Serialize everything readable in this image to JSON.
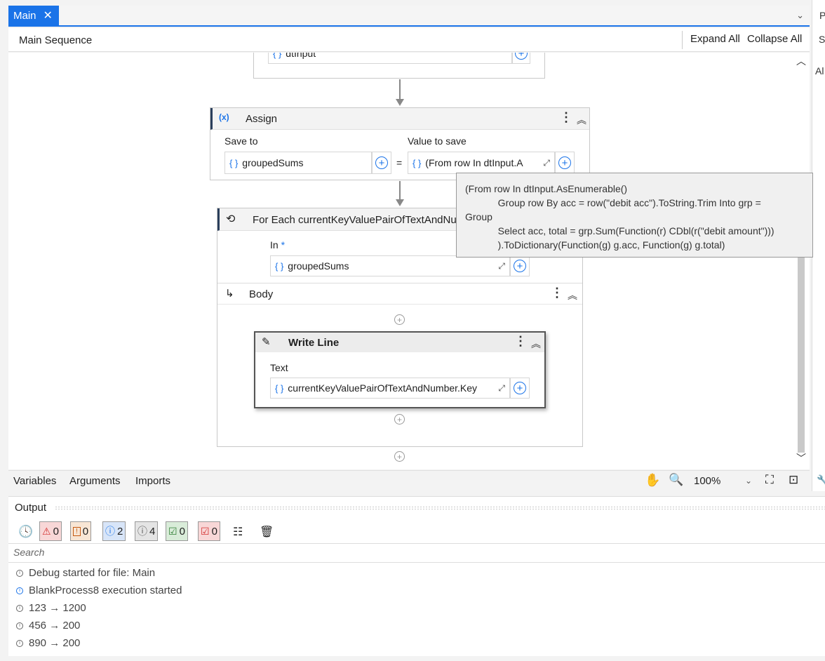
{
  "tabs": {
    "main_label": "Main",
    "close_glyph": "✕",
    "dropdown_glyph": "⌄"
  },
  "right_panel": {
    "label1": "P",
    "label2": "Sy",
    "label3": "Al"
  },
  "breadcrumb": {
    "title": "Main Sequence",
    "expand_all": "Expand All",
    "collapse_all": "Collapse All"
  },
  "canvas": {
    "top_card": {
      "value": "dtInput"
    },
    "assign": {
      "title": "Assign",
      "save_to_label": "Save to",
      "save_to_value": "groupedSums",
      "equals": "=",
      "value_label": "Value to save",
      "value_value": "(From row In dtInput.A"
    },
    "foreach": {
      "title": "For Each currentKeyValuePairOfTextAndNu",
      "in_label": "In",
      "in_required": "*",
      "in_value": "groupedSums",
      "body_label": "Body"
    },
    "writeline": {
      "title": "Write Line",
      "text_label": "Text",
      "text_value": "currentKeyValuePairOfTextAndNumber.Key"
    },
    "tooltip": {
      "line1": "(From row In dtInput.AsEnumerable()",
      "line2": "            Group row By acc = row(\"debit acc\").ToString.Trim Into grp =",
      "line3": "Group",
      "line4": "            Select acc, total = grp.Sum(Function(r) CDbl(r(\"debit amount\")))",
      "line5": "            ).ToDictionary(Function(g) g.acc, Function(g) g.total)"
    }
  },
  "designer_bottom": {
    "variables": "Variables",
    "arguments": "Arguments",
    "imports": "Imports",
    "zoom": "100%"
  },
  "output": {
    "title": "Output",
    "filters": {
      "error": "0",
      "warning": "0",
      "info": "2",
      "trace": "4",
      "success": "0",
      "failed": "0"
    },
    "search_placeholder": "Search",
    "lines": [
      "Debug started for file: Main",
      "BlankProcess8 execution started",
      "123 → 1200",
      "456 → 200",
      "890 → 200"
    ]
  },
  "colors": {
    "accent": "#1a73e8",
    "error": "#d32f2f",
    "warning": "#c55a11",
    "success": "#2e7d32"
  }
}
